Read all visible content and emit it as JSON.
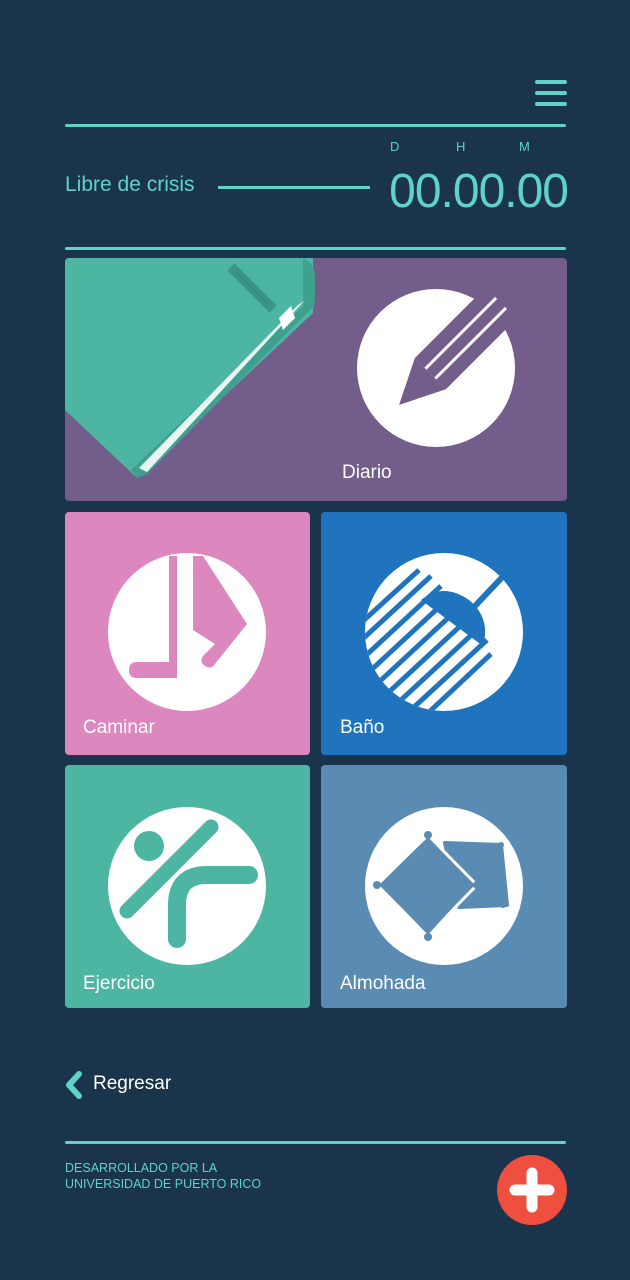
{
  "header": {
    "menu_icon": "hamburger-menu-icon",
    "crisis_label": "Libre de crisis",
    "units": {
      "days": "D",
      "hours": "H",
      "minutes": "M"
    },
    "counter": "00.00.00"
  },
  "tiles": {
    "diario": {
      "label": "Diario",
      "color": "#735d8b",
      "icon": "pencil-icon"
    },
    "caminar": {
      "label": "Caminar",
      "color": "#dc88bf",
      "icon": "walking-feet-icon"
    },
    "bano": {
      "label": "Baño",
      "color": "#1f74bd",
      "icon": "shower-icon"
    },
    "ejercicio": {
      "label": "Ejercicio",
      "color": "#4db6a3",
      "icon": "exercise-figure-icon"
    },
    "almohada": {
      "label": "Almohada",
      "color": "#5a8bb3",
      "icon": "pillow-icon"
    }
  },
  "navigation": {
    "back_label": "Regresar",
    "back_icon": "chevron-left-icon"
  },
  "footer": {
    "line1": "DESARROLLADO POR LA",
    "line2": "UNIVERSIDAD DE PUERTO RICO",
    "help_icon": "plus-icon"
  },
  "colors": {
    "background": "#1a344b",
    "accent": "#5fd3c6",
    "help_button": "#ee4f3f"
  }
}
